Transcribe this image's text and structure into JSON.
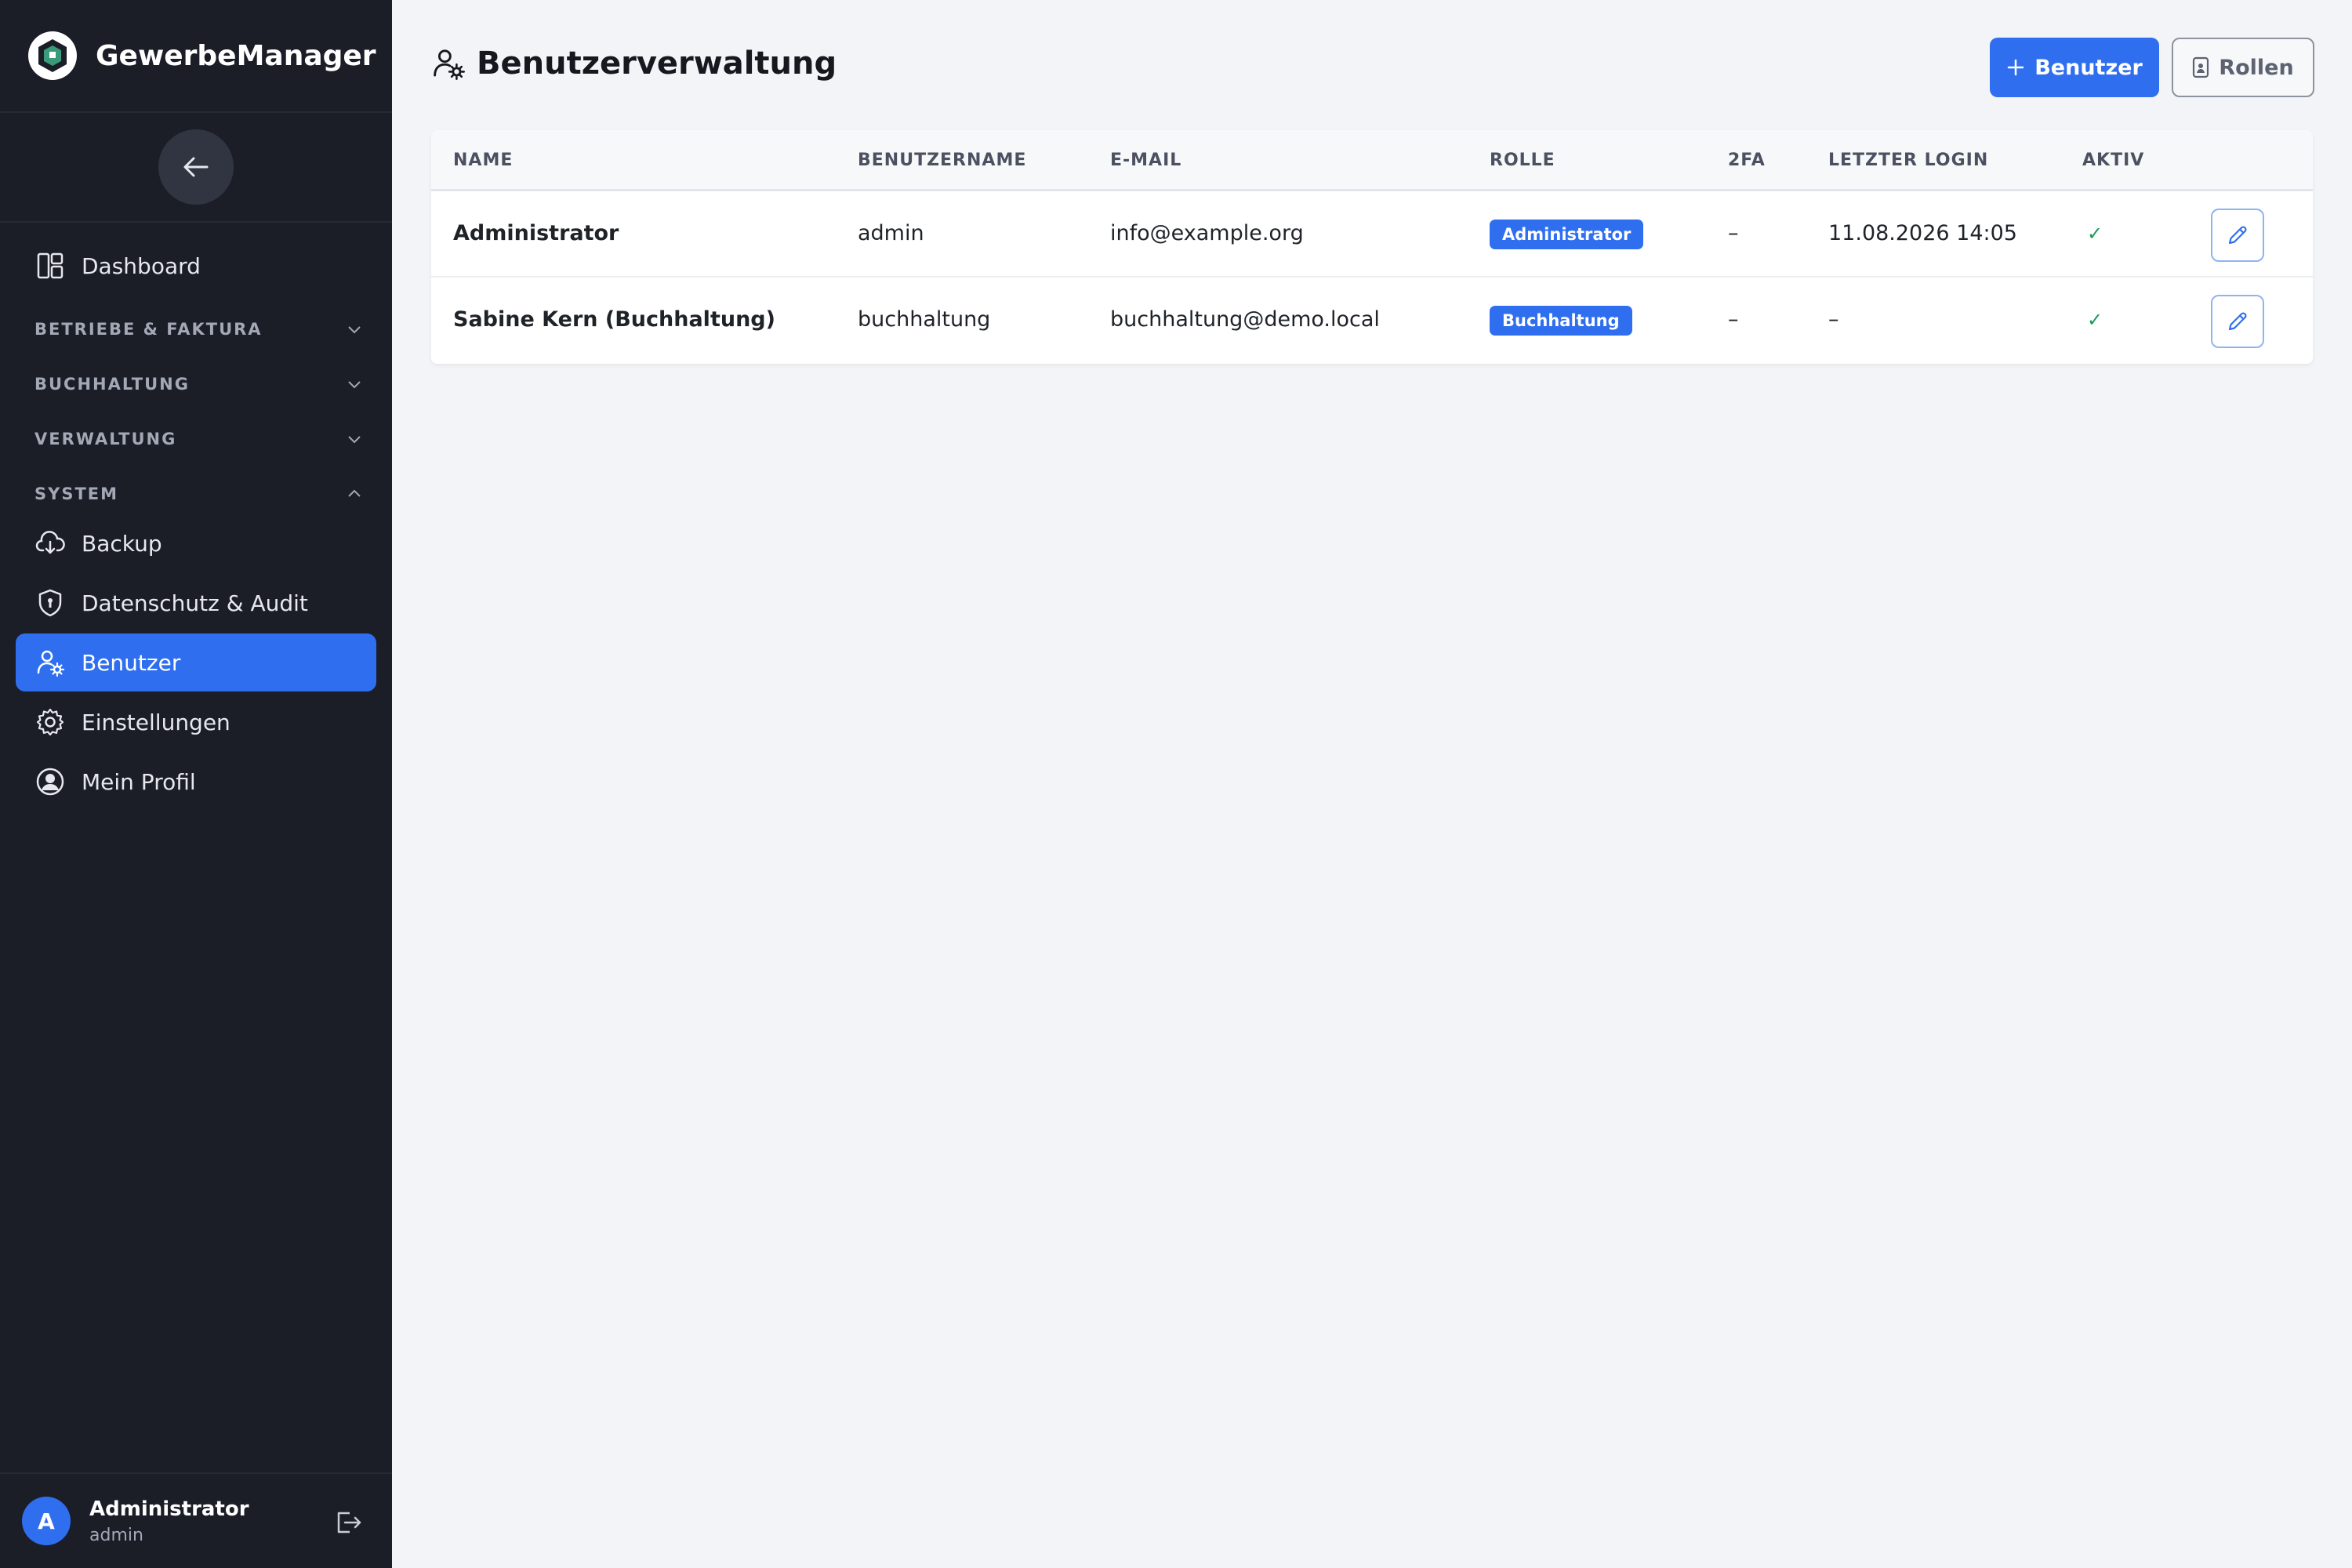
{
  "app": {
    "name": "GewerbeManager"
  },
  "sidebar": {
    "items": [
      {
        "label": "Dashboard"
      },
      {
        "label": "Backup"
      },
      {
        "label": "Datenschutz & Audit"
      },
      {
        "label": "Benutzer"
      },
      {
        "label": "Einstellungen"
      },
      {
        "label": "Mein Profil"
      }
    ],
    "sections": [
      {
        "label": "BETRIEBE & FAKTURA",
        "expanded": false
      },
      {
        "label": "BUCHHALTUNG",
        "expanded": false
      },
      {
        "label": "VERWALTUNG",
        "expanded": false
      },
      {
        "label": "SYSTEM",
        "expanded": true
      }
    ],
    "active_item": "Benutzer"
  },
  "user": {
    "avatar_letter": "A",
    "name": "Administrator",
    "login": "admin"
  },
  "page": {
    "title": "Benutzerverwaltung",
    "add_user_label": "Benutzer",
    "roles_label": "Rollen"
  },
  "table": {
    "columns": [
      "NAME",
      "BENUTZERNAME",
      "E-MAIL",
      "ROLLE",
      "2FA",
      "LETZTER LOGIN",
      "AKTIV"
    ],
    "rows": [
      {
        "name": "Administrator",
        "username": "admin",
        "email": "info@example.org",
        "role": "Administrator",
        "twofa": "–",
        "last_login": "11.08.2026 14:05",
        "active": "✓"
      },
      {
        "name": "Sabine Kern (Buchhaltung)",
        "username": "buchhaltung",
        "email": "buchhaltung@demo.local",
        "role": "Buchhaltung",
        "twofa": "–",
        "last_login": "–",
        "active": "✓"
      }
    ]
  },
  "colors": {
    "sidebar_bg": "#1b1e27",
    "accent": "#2f6fef",
    "page_bg": "#f3f4f7",
    "success": "#1a9a5c"
  }
}
